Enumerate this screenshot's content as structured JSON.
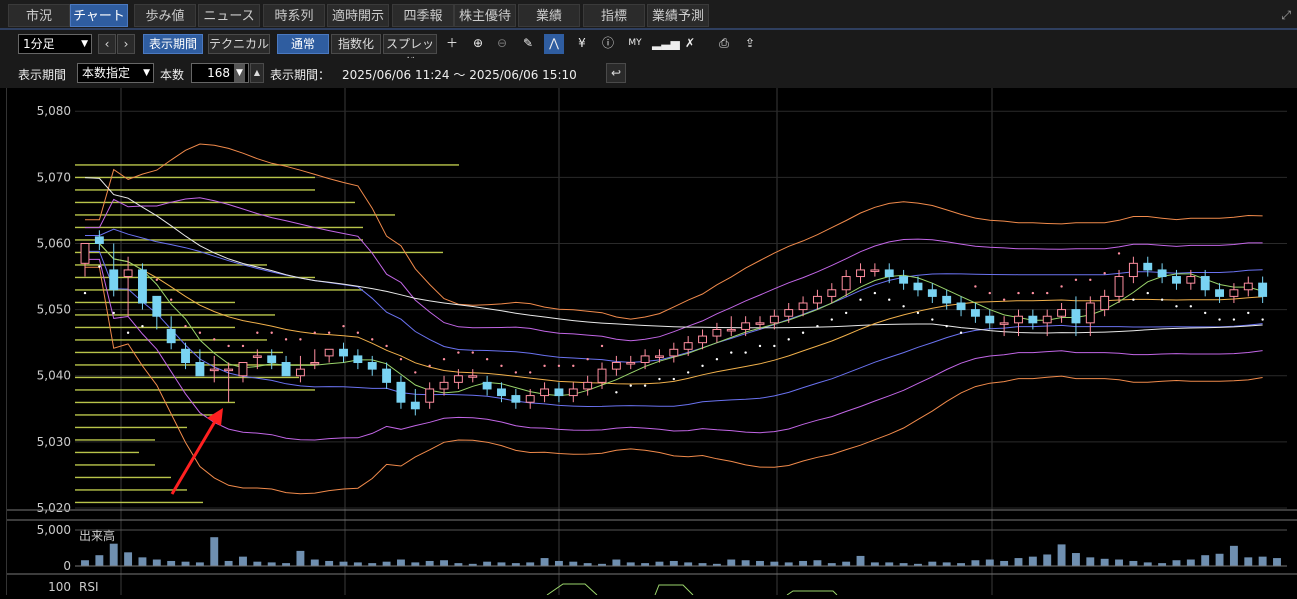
{
  "tabs": [
    "市況",
    "チャート",
    "歩み値",
    "ニュース",
    "時系列",
    "適時開示",
    "四季報",
    "株主優待",
    "業績",
    "指標",
    "業績予測"
  ],
  "active_tab": 1,
  "toolbar": {
    "interval": "1分足",
    "period_btn": "表示期間",
    "technical_btn": "テクニカル",
    "normal_btn": "通常",
    "index_btn": "指数化",
    "spread_btn": "スプレッド",
    "icons": [
      "crosshair-icon",
      "zoom-in-icon",
      "zoom-out-icon",
      "pencil-icon",
      "trend-icon",
      "yen-icon",
      "info-icon",
      "my-icon",
      "histogram-icon",
      "wrench-icon",
      "print-icon",
      "export-icon"
    ]
  },
  "period_bar": {
    "label": "表示期間",
    "mode": "本数指定",
    "count_label": "本数",
    "count": "168",
    "range_label": "表示期間：",
    "range": "2025/06/06 11:24 ～ 2025/06/06 15:10"
  },
  "colors": {
    "up": "#ff8fa0",
    "down": "#79d3f2",
    "bb_outer": "#f08a4b",
    "bb_mid": "#c266e6",
    "bb_inner": "#6a72f0",
    "ma_long": "#e8e8e8",
    "ma_mid": "#f0b04b",
    "ma_short": "#9ad46b",
    "sar": "#ffffff",
    "volume": "#6f8fb0",
    "profile": "#b8c44a",
    "arrow": "#ff2020"
  },
  "chart_data": {
    "type": "candlestick",
    "ylim": [
      5020,
      5082
    ],
    "yticks": [
      5020,
      5030,
      5040,
      5050,
      5060,
      5070,
      5080
    ],
    "candles": [
      [
        5057,
        5060,
        5055,
        5060
      ],
      [
        5061,
        5062,
        5059,
        5060
      ],
      [
        5056,
        5060,
        5052,
        5053
      ],
      [
        5055,
        5058,
        5049,
        5056
      ],
      [
        5056,
        5057,
        5050,
        5051
      ],
      [
        5052,
        5052,
        5047,
        5049
      ],
      [
        5047,
        5049,
        5044,
        5045
      ],
      [
        5044,
        5045,
        5041,
        5042
      ],
      [
        5042,
        5044,
        5040,
        5040
      ],
      [
        5041,
        5043,
        5039,
        5041
      ],
      [
        5041,
        5042,
        5036,
        5041
      ],
      [
        5040,
        5042,
        5039,
        5042
      ],
      [
        5043,
        5044,
        5041,
        5043
      ],
      [
        5043,
        5044,
        5041,
        5042
      ],
      [
        5042,
        5043,
        5040,
        5040
      ],
      [
        5040,
        5043,
        5039,
        5041
      ],
      [
        5042,
        5044,
        5041,
        5042
      ],
      [
        5043,
        5044,
        5042,
        5044
      ],
      [
        5044,
        5045,
        5042,
        5043
      ],
      [
        5043,
        5044,
        5041,
        5042
      ],
      [
        5042,
        5043,
        5040,
        5041
      ],
      [
        5041,
        5042,
        5038,
        5039
      ],
      [
        5039,
        5040,
        5035,
        5036
      ],
      [
        5036,
        5038,
        5034,
        5035
      ],
      [
        5036,
        5039,
        5035,
        5038
      ],
      [
        5038,
        5040,
        5037,
        5039
      ],
      [
        5039,
        5041,
        5038,
        5040
      ],
      [
        5040,
        5041,
        5039,
        5040
      ],
      [
        5039,
        5040,
        5037,
        5038
      ],
      [
        5038,
        5039,
        5036,
        5037
      ],
      [
        5037,
        5038,
        5035,
        5036
      ],
      [
        5036,
        5038,
        5035,
        5037
      ],
      [
        5037,
        5039,
        5036,
        5038
      ],
      [
        5038,
        5039,
        5036,
        5037
      ],
      [
        5037,
        5039,
        5036,
        5038
      ],
      [
        5038,
        5040,
        5037,
        5039
      ],
      [
        5039,
        5042,
        5038,
        5041
      ],
      [
        5041,
        5043,
        5040,
        5042
      ],
      [
        5042,
        5043,
        5041,
        5042
      ],
      [
        5042,
        5044,
        5041,
        5043
      ],
      [
        5043,
        5044,
        5042,
        5043
      ],
      [
        5043,
        5045,
        5042,
        5044
      ],
      [
        5044,
        5046,
        5043,
        5045
      ],
      [
        5045,
        5047,
        5044,
        5046
      ],
      [
        5046,
        5048,
        5045,
        5047
      ],
      [
        5047,
        5049,
        5046,
        5047
      ],
      [
        5047,
        5049,
        5046,
        5048
      ],
      [
        5048,
        5049,
        5047,
        5048
      ],
      [
        5048,
        5050,
        5047,
        5049
      ],
      [
        5049,
        5051,
        5048,
        5050
      ],
      [
        5050,
        5052,
        5049,
        5051
      ],
      [
        5051,
        5053,
        5050,
        5052
      ],
      [
        5052,
        5054,
        5051,
        5053
      ],
      [
        5053,
        5056,
        5052,
        5055
      ],
      [
        5055,
        5057,
        5054,
        5056
      ],
      [
        5056,
        5057,
        5055,
        5056
      ],
      [
        5056,
        5057,
        5054,
        5055
      ],
      [
        5055,
        5056,
        5053,
        5054
      ],
      [
        5054,
        5055,
        5052,
        5053
      ],
      [
        5053,
        5054,
        5051,
        5052
      ],
      [
        5052,
        5053,
        5050,
        5051
      ],
      [
        5051,
        5052,
        5049,
        5050
      ],
      [
        5050,
        5051,
        5048,
        5049
      ],
      [
        5049,
        5050,
        5047,
        5048
      ],
      [
        5048,
        5049,
        5046,
        5048
      ],
      [
        5048,
        5050,
        5046,
        5049
      ],
      [
        5049,
        5050,
        5047,
        5048
      ],
      [
        5048,
        5050,
        5046,
        5049
      ],
      [
        5049,
        5051,
        5048,
        5050
      ],
      [
        5050,
        5052,
        5046,
        5048
      ],
      [
        5048,
        5052,
        5046,
        5051
      ],
      [
        5050,
        5053,
        5049,
        5052
      ],
      [
        5052,
        5056,
        5051,
        5055
      ],
      [
        5055,
        5058,
        5054,
        5057
      ],
      [
        5057,
        5058,
        5055,
        5056
      ],
      [
        5056,
        5057,
        5054,
        5055
      ],
      [
        5055,
        5056,
        5053,
        5054
      ],
      [
        5054,
        5056,
        5053,
        5055
      ],
      [
        5055,
        5056,
        5052,
        5053
      ],
      [
        5053,
        5054,
        5051,
        5052
      ],
      [
        5052,
        5054,
        5051,
        5053
      ],
      [
        5053,
        5055,
        5052,
        5054
      ],
      [
        5054,
        5055,
        5051,
        5052
      ]
    ],
    "volume_label": "出来高",
    "volume_ticks": [
      "5,000",
      "0"
    ],
    "volume": [
      800,
      1500,
      3100,
      1900,
      1200,
      900,
      700,
      600,
      500,
      4000,
      700,
      1300,
      600,
      500,
      400,
      2100,
      900,
      700,
      600,
      500,
      400,
      600,
      900,
      500,
      700,
      800,
      400,
      300,
      600,
      500,
      400,
      500,
      1100,
      700,
      600,
      400,
      300,
      900,
      500,
      400,
      600,
      700,
      500,
      400,
      300,
      900,
      800,
      700,
      600,
      500,
      700,
      800,
      400,
      600,
      1400,
      500,
      500,
      400,
      300,
      600,
      500,
      400,
      800,
      900,
      700,
      1100,
      1300,
      1600,
      3000,
      1800,
      1200,
      1000,
      900,
      700,
      500,
      400,
      800,
      900,
      1500,
      1700,
      2800,
      1200,
      1300,
      1100
    ],
    "rsi_label": "RSI",
    "rsi_tick": "100",
    "profile": [
      48,
      30,
      30,
      35,
      40,
      36,
      36,
      46,
      24,
      30,
      36,
      20,
      25,
      20,
      24,
      26,
      30,
      28,
      30,
      20,
      18,
      14,
      10,
      8,
      10,
      12,
      14,
      16
    ],
    "annotation": "red-arrow"
  }
}
